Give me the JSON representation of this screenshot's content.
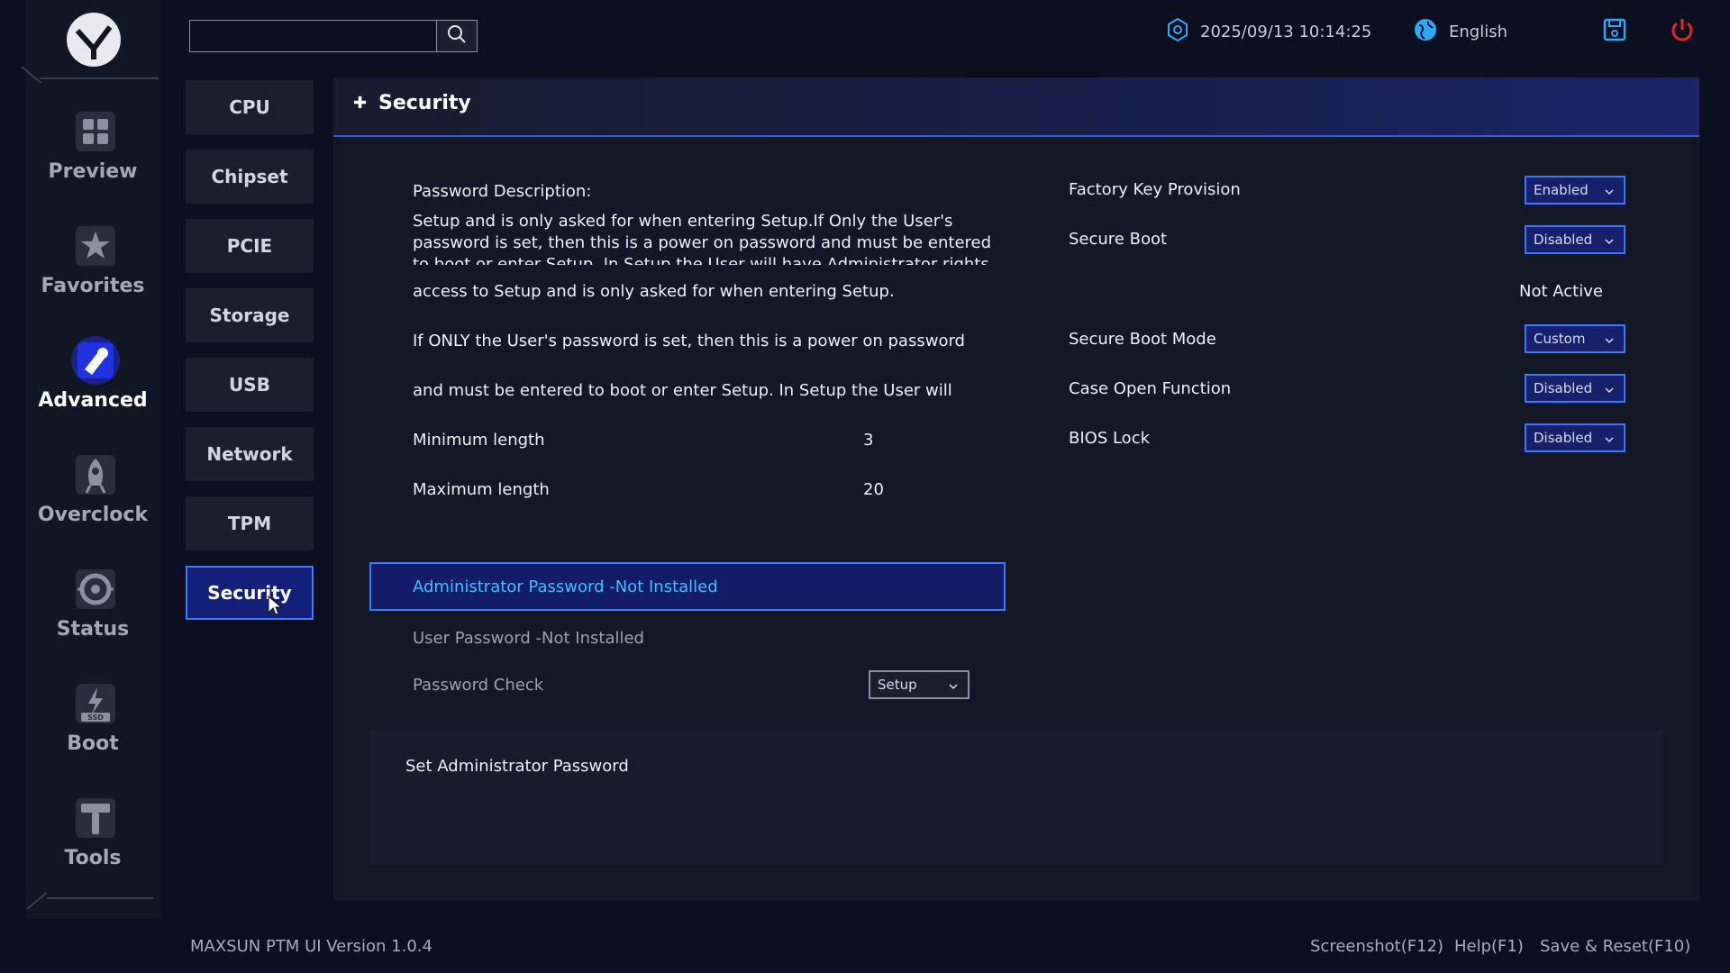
{
  "brand": {
    "version": "MAXSUN PTM UI Version 1.0.4"
  },
  "nav": {
    "items": [
      {
        "label": "Preview",
        "icon": "preview-icon"
      },
      {
        "label": "Favorites",
        "icon": "favorites-icon"
      },
      {
        "label": "Advanced",
        "icon": "advanced-icon",
        "active": true
      },
      {
        "label": "Overclock",
        "icon": "overclock-icon"
      },
      {
        "label": "Status",
        "icon": "status-icon"
      },
      {
        "label": "Boot",
        "icon": "boot-icon"
      },
      {
        "label": "Tools",
        "icon": "tools-icon"
      }
    ]
  },
  "search": {
    "value": ""
  },
  "topbar": {
    "datetime": "2025/09/13 10:14:25",
    "language": "English"
  },
  "submenu": {
    "items": [
      "CPU",
      "Chipset",
      "PCIE",
      "Storage",
      "USB",
      "Network",
      "TPM",
      "Security"
    ],
    "active": "Security"
  },
  "page": {
    "title": "Security",
    "password_description_label": "Password Description:",
    "password_description_text": "Setup and is only asked for when entering Setup.If Only the User's password is set, then this is a power on password and must be entered to boot or enter Setup. In Setup the User will have Administrator rights The password",
    "line_access": "access to Setup and is only asked for when entering Setup.",
    "line_only": "If ONLY the User's password is set, then this is a power on password",
    "line_must": "and must be entered to boot or enter Setup. In Setup the User will",
    "min_length_label": "Minimum length",
    "min_length_value": "3",
    "max_length_label": "Maximum length",
    "max_length_value": "20",
    "admin_password": "Administrator Password -Not Installed",
    "user_password": "User Password -Not Installed",
    "password_check_label": "Password Check",
    "password_check_value": "Setup",
    "help_text": "Set Administrator Password"
  },
  "settings": {
    "factory_key_label": "Factory Key Provision",
    "factory_key_value": "Enabled",
    "secure_boot_label": "Secure Boot",
    "secure_boot_value": "Disabled",
    "secure_boot_status": "Not Active",
    "secure_boot_mode_label": "Secure Boot Mode",
    "secure_boot_mode_value": "Custom",
    "case_open_label": "Case Open Function",
    "case_open_value": "Disabled",
    "bios_lock_label": "BIOS Lock",
    "bios_lock_value": "Disabled"
  },
  "footer": {
    "screenshot": "Screenshot(F12)",
    "help": "Help(F1)",
    "save_reset": "Save & Reset(F10)"
  },
  "colors": {
    "accent": "#3f7bff",
    "selected_text": "#3cc3ff",
    "power": "#e02a2a"
  }
}
